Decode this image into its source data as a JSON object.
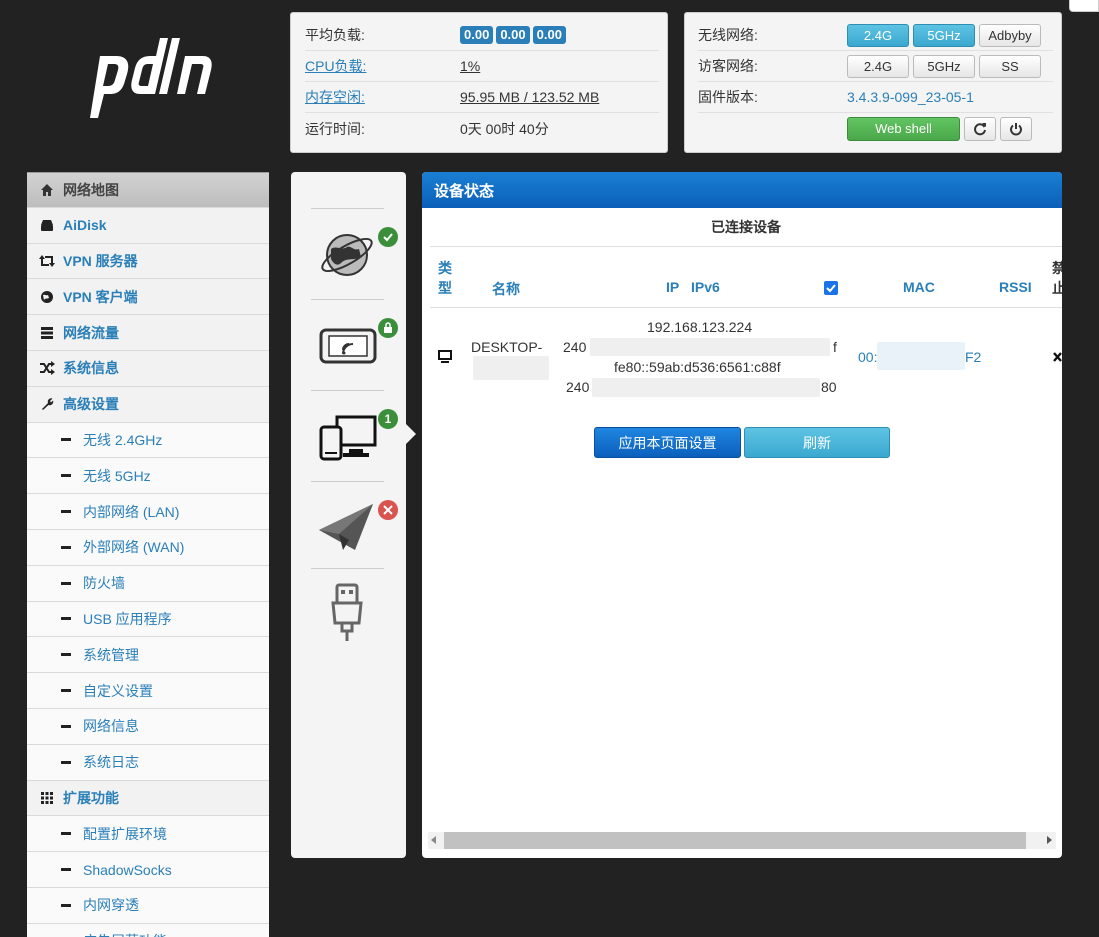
{
  "status": {
    "load_label": "平均负载:",
    "load_values": [
      "0.00",
      "0.00",
      "0.00"
    ],
    "cpu_label": "CPU负载:",
    "cpu_value": "1%",
    "mem_label": "内存空闲:",
    "mem_value": "95.95 MB / 123.52 MB",
    "uptime_label": "运行时间:",
    "uptime_value": "0天 00时 40分"
  },
  "network": {
    "wireless_label": "无线网络:",
    "wireless_buttons": [
      "2.4G",
      "5GHz",
      "Adbyby"
    ],
    "guest_label": "访客网络:",
    "guest_buttons": [
      "2.4G",
      "5GHz",
      "SS"
    ],
    "firmware_label": "固件版本:",
    "firmware_value": "3.4.3.9-099_23-05-1",
    "webshell_label": "Web shell"
  },
  "sidebar": {
    "items": [
      {
        "label": "网络地图",
        "icon": "home-icon",
        "type": "main",
        "active": true
      },
      {
        "label": "AiDisk",
        "icon": "hdd-icon",
        "type": "main"
      },
      {
        "label": "VPN 服务器",
        "icon": "retweet-icon",
        "type": "main"
      },
      {
        "label": "VPN 客户端",
        "icon": "globe-icon",
        "type": "main"
      },
      {
        "label": "网络流量",
        "icon": "server-icon",
        "type": "main"
      },
      {
        "label": "系统信息",
        "icon": "shuffle-icon",
        "type": "main"
      },
      {
        "label": "高级设置",
        "icon": "wrench-icon",
        "type": "main"
      },
      {
        "label": "无线 2.4GHz",
        "type": "sub"
      },
      {
        "label": "无线 5GHz",
        "type": "sub"
      },
      {
        "label": "内部网络 (LAN)",
        "type": "sub"
      },
      {
        "label": "外部网络 (WAN)",
        "type": "sub"
      },
      {
        "label": "防火墙",
        "type": "sub"
      },
      {
        "label": "USB 应用程序",
        "type": "sub"
      },
      {
        "label": "系统管理",
        "type": "sub"
      },
      {
        "label": "自定义设置",
        "type": "sub"
      },
      {
        "label": "网络信息",
        "type": "sub"
      },
      {
        "label": "系统日志",
        "type": "sub"
      },
      {
        "label": "扩展功能",
        "icon": "grid-icon",
        "type": "main"
      },
      {
        "label": "配置扩展环境",
        "type": "sub"
      },
      {
        "label": "ShadowSocks",
        "type": "sub"
      },
      {
        "label": "内网穿透",
        "type": "sub"
      },
      {
        "label": "广告屏蔽功能",
        "type": "sub"
      }
    ]
  },
  "icon_column": {
    "clients_badge": "1"
  },
  "device_panel": {
    "title": "设备状态",
    "subtitle": "已连接设备",
    "columns": {
      "type": "类\n型",
      "name": "名称",
      "ip": "IP",
      "ipv6": "IPv6",
      "mac": "MAC",
      "rssi": "RSSI",
      "block": "禁\n止"
    },
    "device": {
      "name": "DESKTOP-",
      "ipv4": "192.168.123.224",
      "ipv6_1_prefix": "240",
      "ipv6_1_suffix": "f",
      "ipv6_2": "fe80::59ab:d536:6561:c88f",
      "ipv6_3_prefix": "240",
      "ipv6_3_suffix": "80",
      "mac_prefix": "00:",
      "mac_suffix": "F2"
    },
    "apply_label": "应用本页面设置",
    "refresh_label": "刷新"
  }
}
